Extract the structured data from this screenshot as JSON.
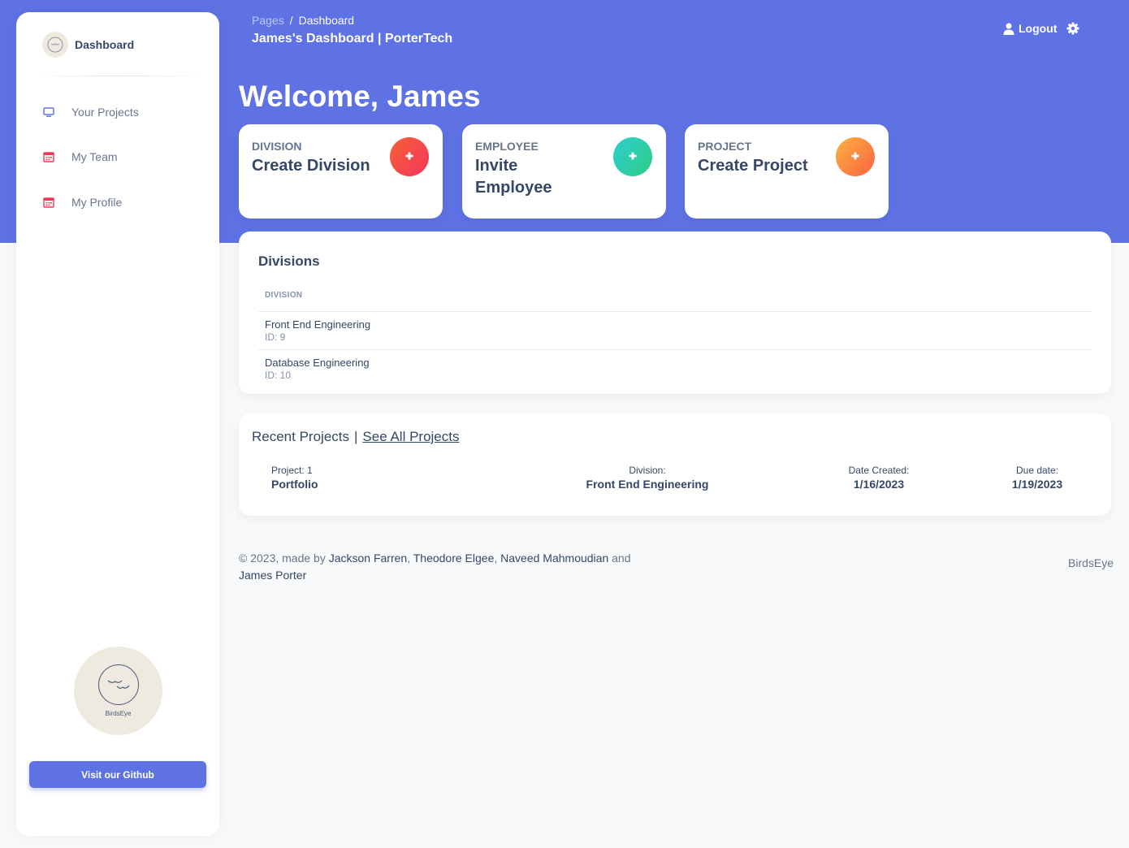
{
  "sidebar": {
    "brand_name": "Dashboard",
    "items": [
      {
        "label": "Your Projects",
        "icon": "monitor-icon"
      },
      {
        "label": "My Team",
        "icon": "calendar-icon"
      },
      {
        "label": "My Profile",
        "icon": "calendar-icon"
      }
    ],
    "logo_text": "BirdsEye",
    "github_button": "Visit our Github"
  },
  "header": {
    "breadcrumb_root": "Pages",
    "breadcrumb_separator": "/",
    "breadcrumb_current": "Dashboard",
    "title": "James's Dashboard | PorterTech",
    "logout_label": "Logout"
  },
  "welcome": "Welcome, James",
  "action_cards": [
    {
      "category": "Division",
      "title": "Create Division",
      "accent": "#f5365c"
    },
    {
      "category": "Employee",
      "title": "Invite Employee",
      "accent": "#2dce89"
    },
    {
      "category": "Project",
      "title": "Create Project",
      "accent": "#fb6340"
    }
  ],
  "divisions": {
    "title": "Divisions",
    "column_header": "Division",
    "rows": [
      {
        "name": "Front End Engineering",
        "id": "ID: 9"
      },
      {
        "name": "Database Engineering",
        "id": "ID: 10"
      }
    ]
  },
  "recent_projects": {
    "title": "Recent Projects",
    "separator": "|",
    "see_all": "See All Projects",
    "project": {
      "project_label": "Project: 1",
      "project_name": "Portfolio",
      "division_label": "Division:",
      "division_value": "Front End Engineering",
      "created_label": "Date Created:",
      "created_value": "1/16/2023",
      "due_label": "Due date:",
      "due_value": "1/19/2023"
    }
  },
  "footer": {
    "prefix": "© 2023, made by",
    "authors": [
      "Jackson Farren",
      "Theodore Elgee",
      "Naveed Mahmoudian",
      "James Porter"
    ],
    "comma": ",",
    "and": "and",
    "brand": "BirdsEye"
  },
  "colors": {
    "primary": "#5e72e4",
    "text_dark": "#344767",
    "text_muted": "#67748e"
  }
}
